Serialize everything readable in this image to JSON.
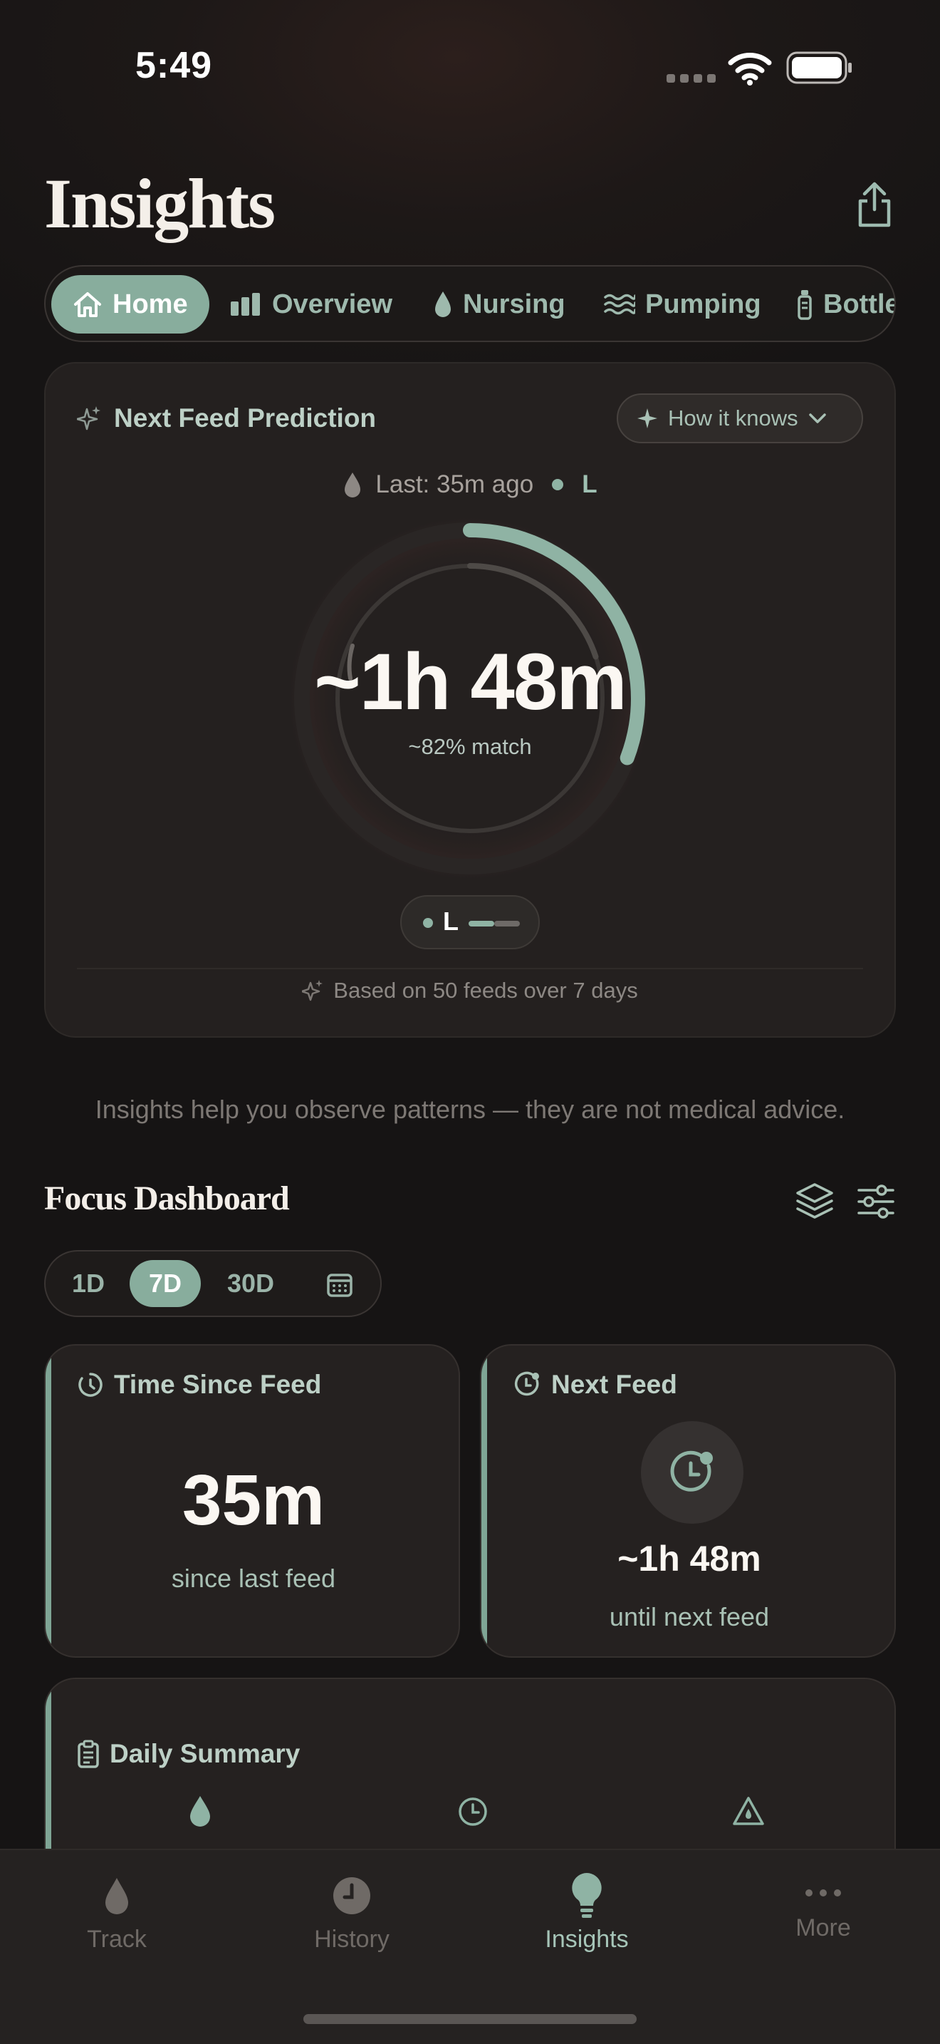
{
  "status_bar": {
    "time": "5:49"
  },
  "page": {
    "title": "Insights"
  },
  "tabs": [
    {
      "label": "Home",
      "icon": "house-icon"
    },
    {
      "label": "Overview",
      "icon": "bars-icon"
    },
    {
      "label": "Nursing",
      "icon": "drop-icon"
    },
    {
      "label": "Pumping",
      "icon": "waves-icon"
    },
    {
      "label": "Bottle",
      "icon": "bottle-icon"
    }
  ],
  "prediction": {
    "title": "Next Feed Prediction",
    "how_button": "How it knows",
    "last_feed": "Last: 35m ago",
    "last_side": "L",
    "eta": "~1h 48m",
    "match": "~82% match",
    "side": "L",
    "based_on": "Based on 50 feeds over 7 days",
    "ring_progress": 0.22
  },
  "disclaimer": "Insights help you observe patterns — they are not medical advice.",
  "focus": {
    "title": "Focus Dashboard",
    "ranges": [
      "1D",
      "7D",
      "30D"
    ],
    "active_range": "7D"
  },
  "cards": {
    "time_since": {
      "title": "Time Since Feed",
      "value": "35m",
      "sub": "since last feed"
    },
    "next_feed": {
      "title": "Next Feed",
      "value": "~1h 48m",
      "sub": "until next feed"
    },
    "daily": {
      "title": "Daily Summary"
    }
  },
  "tabbar": [
    {
      "label": "Track",
      "icon": "drop-icon"
    },
    {
      "label": "History",
      "icon": "clock-icon"
    },
    {
      "label": "Insights",
      "icon": "lightbulb-icon"
    },
    {
      "label": "More",
      "icon": "ellipsis-icon"
    }
  ],
  "colors": {
    "accent": "#88ad9d",
    "background": "#171515",
    "card": "#252120"
  }
}
